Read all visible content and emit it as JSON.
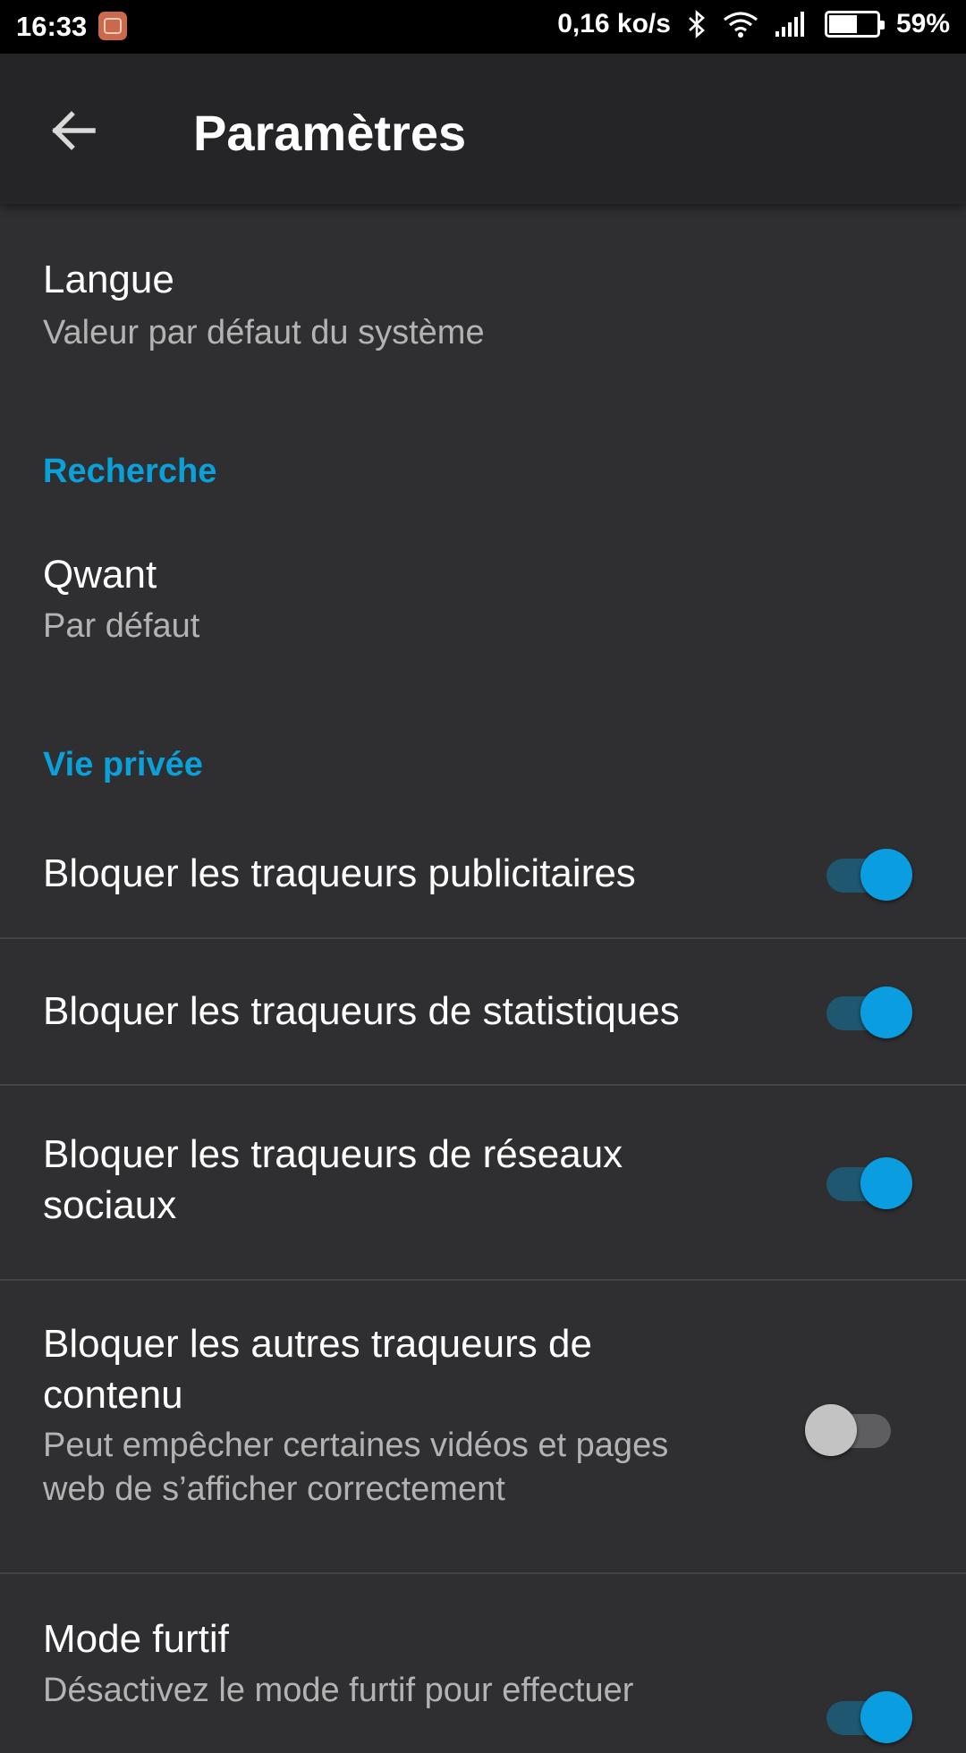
{
  "status_bar": {
    "time": "16:33",
    "app_icon": "mi-app-icon",
    "net_speed": "0,16 ko/s",
    "bluetooth_icon": "bluetooth-icon",
    "wifi_icon": "wifi-icon",
    "signal_icon": "cell-signal-icon",
    "battery_level": 0.59,
    "battery_pct": "59%"
  },
  "app_bar": {
    "back_icon": "arrow-back-icon",
    "title": "Paramètres"
  },
  "settings": {
    "language": {
      "title": "Langue",
      "subtitle": "Valeur par défaut du système"
    },
    "search_header": "Recherche",
    "search_engine": {
      "title": "Qwant",
      "subtitle": "Par défaut"
    },
    "privacy_header": "Vie privée",
    "toggles": [
      {
        "title": "Bloquer les traqueurs publicitaires",
        "on": true
      },
      {
        "title": "Bloquer les traqueurs de statistiques",
        "on": true
      },
      {
        "title_line1": "Bloquer les traqueurs de réseaux",
        "title_line2": "sociaux",
        "on": true
      },
      {
        "title_line1": "Bloquer les autres traqueurs de",
        "title_line2": "contenu",
        "subtitle_line1": "Peut empêcher certaines vidéos et pages",
        "subtitle_line2": "web de s’afficher correctement",
        "on": false
      },
      {
        "title": "Mode furtif",
        "subtitle": "Désactivez le mode furtif pour effectuer",
        "on": true
      }
    ]
  },
  "colors": {
    "background": "#2f2f31",
    "app_bar": "#252527",
    "accent": "#0aa1db",
    "toggle_on": "#0a9ee0"
  }
}
